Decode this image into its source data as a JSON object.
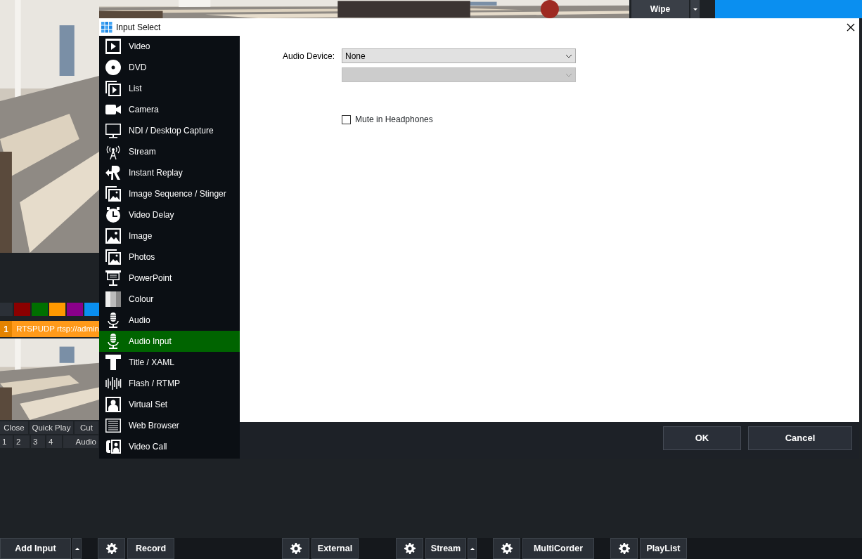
{
  "background": {
    "transition_button": "Wipe",
    "swatches": [
      {
        "color": "#2b3037"
      },
      {
        "color": "#8b0000"
      },
      {
        "color": "#007000"
      },
      {
        "color": "#ff9900"
      },
      {
        "color": "#8a008a"
      },
      {
        "color": "#0a8ff0"
      }
    ],
    "input": {
      "number": "1",
      "title": "RTSPUDP rtsp://admin"
    },
    "input_buttons": [
      "Close",
      "Quick Play",
      "Cut"
    ],
    "input_shortcuts": [
      "1",
      "2",
      "3",
      "4",
      "Audio"
    ]
  },
  "dialog": {
    "title": "Input Select",
    "types": [
      {
        "label": "Video",
        "selected": false
      },
      {
        "label": "DVD",
        "selected": false
      },
      {
        "label": "List",
        "selected": false
      },
      {
        "label": "Camera",
        "selected": false
      },
      {
        "label": "NDI / Desktop Capture",
        "selected": false
      },
      {
        "label": "Stream",
        "selected": false
      },
      {
        "label": "Instant Replay",
        "selected": false
      },
      {
        "label": "Image Sequence / Stinger",
        "selected": false
      },
      {
        "label": "Video Delay",
        "selected": false
      },
      {
        "label": "Image",
        "selected": false
      },
      {
        "label": "Photos",
        "selected": false
      },
      {
        "label": "PowerPoint",
        "selected": false
      },
      {
        "label": "Colour",
        "selected": false
      },
      {
        "label": "Audio",
        "selected": false
      },
      {
        "label": "Audio Input",
        "selected": true
      },
      {
        "label": "Title / XAML",
        "selected": false
      },
      {
        "label": "Flash / RTMP",
        "selected": false
      },
      {
        "label": "Virtual Set",
        "selected": false
      },
      {
        "label": "Web Browser",
        "selected": false
      },
      {
        "label": "Video Call",
        "selected": false
      }
    ],
    "audio_device": {
      "label": "Audio Device:",
      "value": "None"
    },
    "channel_select": {
      "disabled": true
    },
    "mute_in_headphones": {
      "label": "Mute in Headphones",
      "checked": false
    },
    "buttons": [
      "OK",
      "Cancel"
    ]
  },
  "bottom_bar": [
    {
      "kind": "button",
      "label": "Add Input"
    },
    {
      "kind": "dropdown"
    },
    {
      "kind": "settings"
    },
    {
      "kind": "button",
      "label": "Record"
    },
    {
      "kind": "settings"
    },
    {
      "kind": "button",
      "label": "External"
    },
    {
      "kind": "settings"
    },
    {
      "kind": "button",
      "label": "Stream"
    },
    {
      "kind": "dropdown"
    },
    {
      "kind": "settings"
    },
    {
      "kind": "button",
      "label": "MultiCorder"
    },
    {
      "kind": "settings"
    },
    {
      "kind": "button",
      "label": "PlayList"
    }
  ]
}
